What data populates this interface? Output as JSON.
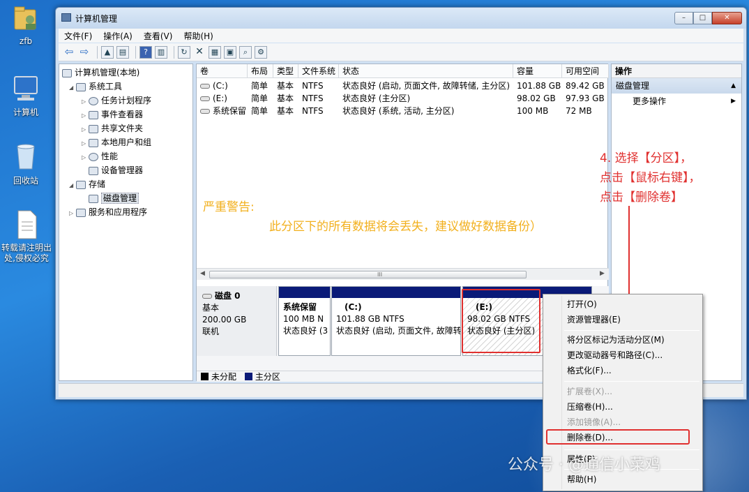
{
  "desktop": {
    "icons": [
      {
        "label": "zfb"
      },
      {
        "label": "计算机"
      },
      {
        "label": "回收站"
      },
      {
        "label": "转载请注明出处,侵权必究"
      }
    ]
  },
  "window": {
    "title": "计算机管理",
    "buttons": {
      "minimize": "–",
      "maximize": "□",
      "close": "✕"
    }
  },
  "menubar": [
    "文件(F)",
    "操作(A)",
    "查看(V)",
    "帮助(H)"
  ],
  "tree": {
    "items": [
      {
        "label": "计算机管理(本地)",
        "exp": ""
      },
      {
        "label": "系统工具",
        "exp": "◢"
      },
      {
        "label": "任务计划程序",
        "exp": "▷"
      },
      {
        "label": "事件查看器",
        "exp": "▷"
      },
      {
        "label": "共享文件夹",
        "exp": "▷"
      },
      {
        "label": "本地用户和组",
        "exp": "▷"
      },
      {
        "label": "性能",
        "exp": "▷"
      },
      {
        "label": "设备管理器",
        "exp": ""
      },
      {
        "label": "存储",
        "exp": "◢"
      },
      {
        "label": "磁盘管理",
        "exp": ""
      },
      {
        "label": "服务和应用程序",
        "exp": "▷"
      }
    ]
  },
  "volumes": {
    "headers": [
      "卷",
      "布局",
      "类型",
      "文件系统",
      "状态",
      "容量",
      "可用空间"
    ],
    "rows": [
      [
        "(C:)",
        "简单",
        "基本",
        "NTFS",
        "状态良好 (启动, 页面文件, 故障转储, 主分区)",
        "101.88 GB",
        "89.42 GB"
      ],
      [
        "(E:)",
        "简单",
        "基本",
        "NTFS",
        "状态良好 (主分区)",
        "98.02 GB",
        "97.93 GB"
      ],
      [
        "系统保留",
        "简单",
        "基本",
        "NTFS",
        "状态良好 (系统, 活动, 主分区)",
        "100 MB",
        "72 MB"
      ]
    ]
  },
  "scrollbar": {
    "grip": "III"
  },
  "disk": {
    "name": "磁盘 0",
    "type": "基本",
    "size": "200.00 GB",
    "status": "联机",
    "partitions": [
      {
        "name": "系统保留",
        "size": "100 MB N",
        "status": "状态良好 (3"
      },
      {
        "name": "(C:)",
        "size": "101.88 GB NTFS",
        "status": "状态良好 (启动, 页面文件, 故障转"
      },
      {
        "name": "(E:)",
        "size": "98.02 GB NTFS",
        "status": "状态良好 (主分区)"
      }
    ]
  },
  "legend": {
    "unallocated": "未分配",
    "primary": "主分区"
  },
  "actions": {
    "header": "操作",
    "group": "磁盘管理",
    "more": "更多操作"
  },
  "annotations": {
    "warning_title": "严重警告:",
    "warning_body": "此分区下的所有数据将会丢失，建议做好数据备份）",
    "step": "4. 选择【分区】，\n点击【鼠标右键】，\n点击【删除卷】"
  },
  "context_menu": {
    "items": [
      {
        "label": "打开(O)",
        "disabled": false
      },
      {
        "label": "资源管理器(E)",
        "disabled": false
      },
      {
        "label": "将分区标记为活动分区(M)",
        "disabled": false
      },
      {
        "label": "更改驱动器号和路径(C)...",
        "disabled": false
      },
      {
        "label": "格式化(F)...",
        "disabled": false
      },
      {
        "label": "扩展卷(X)...",
        "disabled": true
      },
      {
        "label": "压缩卷(H)...",
        "disabled": false
      },
      {
        "label": "添加镜像(A)...",
        "disabled": true
      },
      {
        "label": "删除卷(D)...",
        "disabled": false
      },
      {
        "label": "属性(P)",
        "disabled": false
      },
      {
        "label": "帮助(H)",
        "disabled": false
      }
    ]
  },
  "watermark": "公众号 · @通信小菜鸡",
  "colors": {
    "primary_partition": "#0a1a78",
    "annotation_red": "#e0302f",
    "warning_yellow": "#f2b01e"
  }
}
